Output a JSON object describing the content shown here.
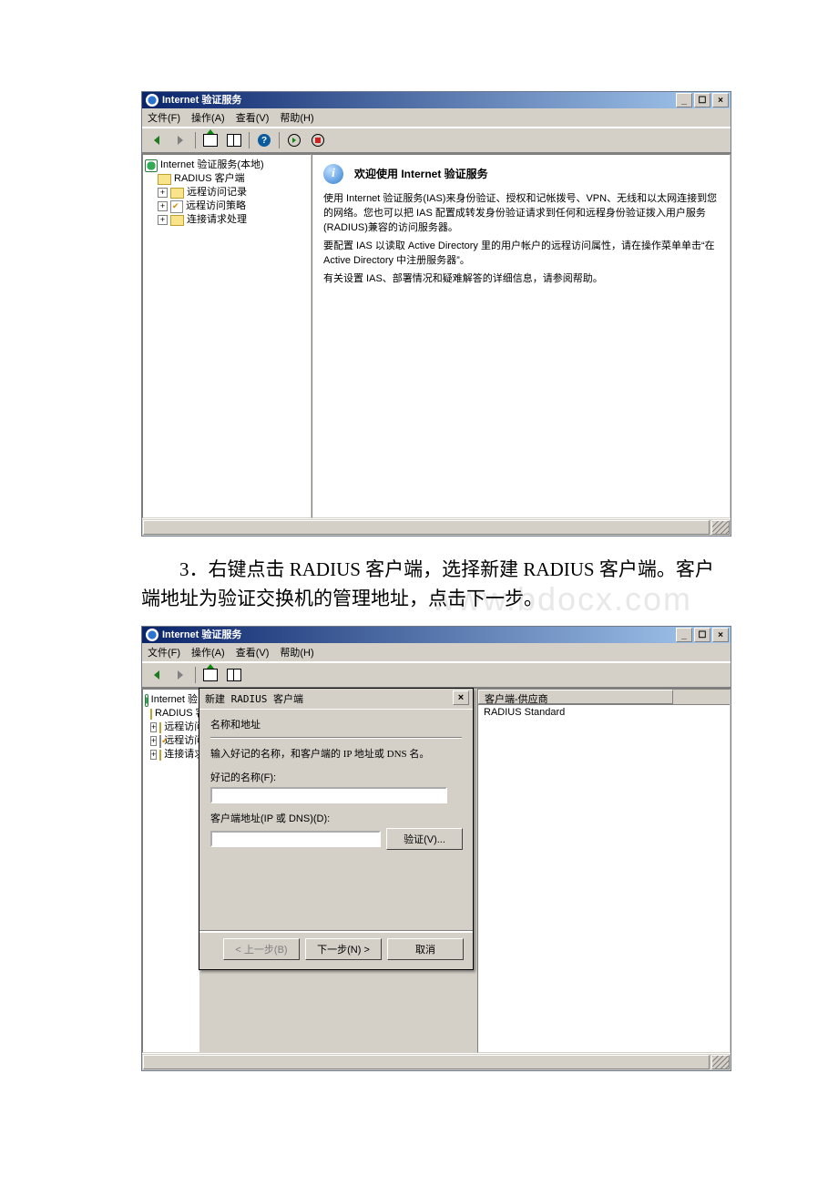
{
  "win1": {
    "title": "Internet 验证服务",
    "menu": {
      "file": "文件(F)",
      "action": "操作(A)",
      "view": "查看(V)",
      "help": "帮助(H)"
    },
    "tree": {
      "root": "Internet 验证服务(本地)",
      "n1": "RADIUS 客户端",
      "n2": "远程访问记录",
      "n3": "远程访问策略",
      "n4": "连接请求处理"
    },
    "content": {
      "welcome": "欢迎使用 Internet 验证服务",
      "p1": "使用 Internet 验证服务(IAS)来身份验证、授权和记帐拨号、VPN、无线和以太网连接到您的网络。您也可以把 IAS 配置成转发身份验证请求到任何和远程身份验证拨入用户服务(RADIUS)兼容的访问服务器。",
      "p2": "要配置 IAS 以读取 Active Directory 里的用户帐户的远程访问属性，请在操作菜单单击“在 Active Directory 中注册服务器”。",
      "p3": "有关设置 IAS、部署情况和疑难解答的详细信息，请参阅帮助。"
    }
  },
  "doc": {
    "step3": "3．右键点击 RADIUS 客户端，选择新建 RADIUS 客户端。客户端地址为验证交换机的管理地址，点击下一步。",
    "watermark": "www.bdocx.com"
  },
  "win2": {
    "title": "Internet 验证服务",
    "menu": {
      "file": "文件(F)",
      "action": "操作(A)",
      "view": "查看(V)",
      "help": "帮助(H)"
    },
    "tree": {
      "root": "Internet 验",
      "n1": "RADIUS 客",
      "n2": "远程访问",
      "n3": "远程访问",
      "n4": "连接请求"
    },
    "list": {
      "col_vendor": "客户端-供应商",
      "row_vendor": "RADIUS Standard"
    },
    "dialog": {
      "title": "新建 RADIUS 客户端",
      "heading": "名称和地址",
      "note": "输入好记的名称，和客户端的 IP 地址或 DNS 名。",
      "label_name": "好记的名称(F):",
      "label_addr": "客户端地址(IP 或 DNS)(D):",
      "btn_verify": "验证(V)...",
      "btn_back": "< 上一步(B)",
      "btn_next": "下一步(N) >",
      "btn_cancel": "取消"
    }
  }
}
